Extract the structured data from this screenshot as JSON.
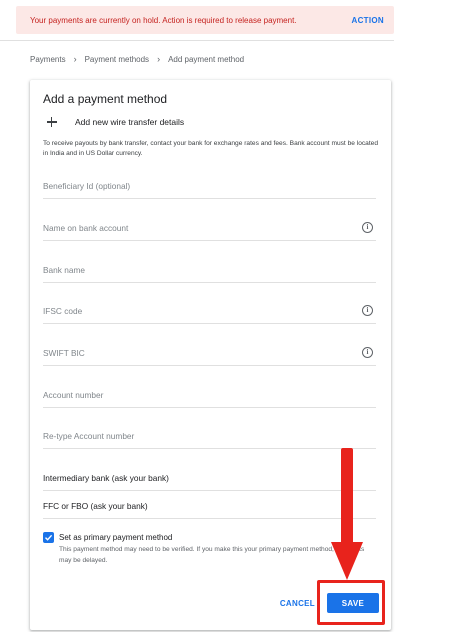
{
  "alert": {
    "message": "Your payments are currently on hold. Action is required to release payment.",
    "action_label": "ACTION"
  },
  "breadcrumb": {
    "items": [
      "Payments",
      "Payment methods",
      "Add payment method"
    ]
  },
  "card": {
    "title": "Add a payment method",
    "add_label": "Add new wire transfer details",
    "info_text": "To receive payouts by bank transfer, contact your bank for exchange rates and fees. Bank account must be located in India and in US Dollar currency."
  },
  "fields": {
    "beneficiary_id": {
      "placeholder": "Beneficiary Id (optional)",
      "value": ""
    },
    "name_on_account": {
      "placeholder": "Name on bank account",
      "value": ""
    },
    "bank_name": {
      "placeholder": "Bank name",
      "value": ""
    },
    "ifsc_code": {
      "placeholder": "IFSC code",
      "value": ""
    },
    "swift_bic": {
      "placeholder": "SWIFT BIC",
      "value": ""
    },
    "account_number": {
      "placeholder": "Account number",
      "value": ""
    },
    "retype_account_number": {
      "placeholder": "Re-type Account number",
      "value": ""
    },
    "intermediary_bank": {
      "placeholder": "Intermediary bank (ask your bank)",
      "value": ""
    },
    "ffc_fbo": {
      "placeholder": "FFC or FBO (ask your bank)",
      "value": ""
    }
  },
  "primary": {
    "checked": true,
    "label": "Set as primary payment method",
    "help": "This payment method may need to be verified. If you make this your primary payment method, payments may be delayed."
  },
  "actions": {
    "cancel_label": "CANCEL",
    "save_label": "SAVE"
  },
  "colors": {
    "accent": "#1a73e8",
    "alert_bg": "#fce8e6",
    "alert_text": "#c5221f",
    "annotation_red": "#e8231c"
  },
  "icons": [
    "plus-icon",
    "info-icon",
    "checkmark-icon",
    "annotation-arrow-icon"
  ]
}
